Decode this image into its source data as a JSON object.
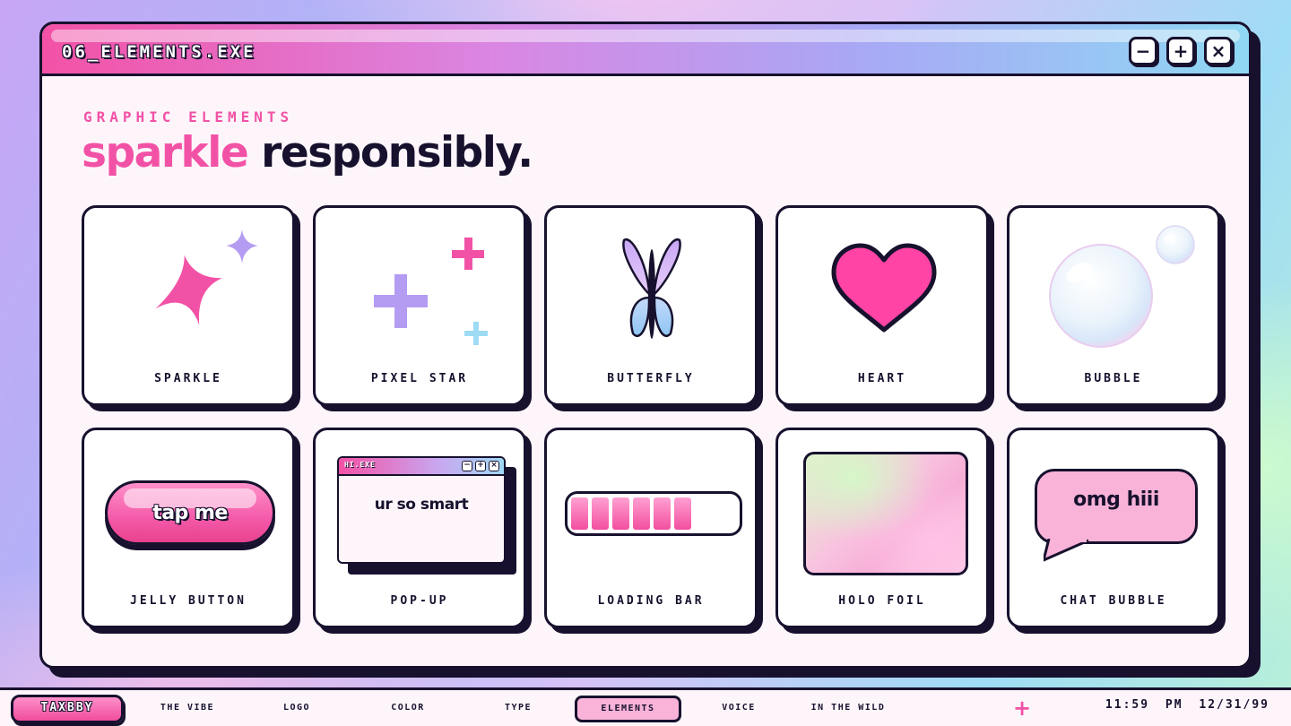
{
  "window": {
    "title": "06_ELEMENTS.EXE",
    "controls": {
      "minimize": "−",
      "maximize": "+",
      "close": "×"
    }
  },
  "header": {
    "eyebrow": "GRAPHIC ELEMENTS",
    "headline_accent": "sparkle",
    "headline_rest": "responsibly."
  },
  "cards": [
    {
      "label": "SPARKLE",
      "icon": "sparkle-icon"
    },
    {
      "label": "PIXEL STAR",
      "icon": "pixel-star-icon"
    },
    {
      "label": "BUTTERFLY",
      "icon": "butterfly-icon"
    },
    {
      "label": "HEART",
      "icon": "heart-icon"
    },
    {
      "label": "BUBBLE",
      "icon": "bubble-icon"
    },
    {
      "label": "JELLY BUTTON",
      "sample_text": "tap me"
    },
    {
      "label": "POP-UP",
      "popup_title": "HI.EXE",
      "sample_text": "ur so smart"
    },
    {
      "label": "LOADING BAR",
      "progress_segments": 6
    },
    {
      "label": "HOLO FOIL"
    },
    {
      "label": "CHAT BUBBLE",
      "sample_text": "omg hiii"
    }
  ],
  "taskbar": {
    "start_label": "TAXBBY",
    "nav": [
      "THE VIBE",
      "LOGO",
      "COLOR",
      "TYPE",
      "ELEMENTS",
      "VOICE",
      "IN THE WILD"
    ],
    "active_nav": "ELEMENTS",
    "time": "11:59 PM",
    "date": "12/31/99"
  },
  "colors": {
    "ink": "#17112e",
    "pink": "#f252a6",
    "lavender": "#b49cf2",
    "sky": "#9edcf4",
    "paper": "#fdf5fa"
  }
}
